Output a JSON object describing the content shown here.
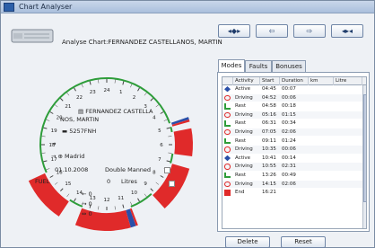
{
  "window": {
    "title": "Chart Analyser"
  },
  "header": {
    "chart_label": "Analyse Chart:FERNANDEZ CASTELLANOS, MARTIN"
  },
  "nav": [
    "◂◆▸",
    "⇦",
    "⇨",
    "◂▸◂"
  ],
  "dial": {
    "hours": [
      "24",
      "1",
      "2",
      "3",
      "4",
      "5",
      "6",
      "7",
      "8",
      "9",
      "10",
      "11",
      "12",
      "13",
      "14",
      "15",
      "16",
      "17",
      "18",
      "19",
      "20",
      "21",
      "22",
      "23"
    ],
    "driver_line1": "FERNANDEZ CASTELLA",
    "driver_line2": "NOS, MARTIN",
    "vehicle": "5257FNH",
    "arrow_19": "→",
    "arrow_18": "→",
    "place_label": "Madrid",
    "date": "01.10.2008",
    "crew_mode": "Double Manned",
    "fuel_label": "FUEL",
    "fuel_value": "0",
    "litres_label": "Litres",
    "marks": [
      "← 0",
      "→ 0",
      "⇔ 0"
    ]
  },
  "tabs": [
    "Modes",
    "Faults",
    "Bonuses"
  ],
  "table": {
    "headers": [
      "Activity",
      "Start",
      "Duration",
      "km",
      "Litre"
    ],
    "rows": [
      {
        "icon": "work",
        "activity": "Active",
        "start": "04:45",
        "duration": "00:07"
      },
      {
        "icon": "drive",
        "activity": "Driving",
        "start": "04:52",
        "duration": "00:06"
      },
      {
        "icon": "rest",
        "activity": "Rest",
        "start": "04:58",
        "duration": "00:18"
      },
      {
        "icon": "drive",
        "activity": "Driving",
        "start": "05:16",
        "duration": "01:15"
      },
      {
        "icon": "rest",
        "activity": "Rest",
        "start": "06:31",
        "duration": "00:34"
      },
      {
        "icon": "drive",
        "activity": "Driving",
        "start": "07:05",
        "duration": "02:06"
      },
      {
        "icon": "rest",
        "activity": "Rest",
        "start": "09:11",
        "duration": "01:24"
      },
      {
        "icon": "drive",
        "activity": "Driving",
        "start": "10:35",
        "duration": "00:06"
      },
      {
        "icon": "work",
        "activity": "Active",
        "start": "10:41",
        "duration": "00:14"
      },
      {
        "icon": "drive",
        "activity": "Driving",
        "start": "10:55",
        "duration": "02:31"
      },
      {
        "icon": "rest",
        "activity": "Rest",
        "start": "13:26",
        "duration": "00:49"
      },
      {
        "icon": "drive",
        "activity": "Driving",
        "start": "14:15",
        "duration": "02:06"
      },
      {
        "icon": "end",
        "activity": "End",
        "start": "16:21",
        "duration": ""
      }
    ]
  },
  "buttons": {
    "delete": "Delete",
    "reset": "Reset"
  },
  "colors": {
    "driving": "#e02a2a",
    "rest": "#2e9d3a",
    "active": "#2a4fa8",
    "accent": "#2c5fa8"
  }
}
